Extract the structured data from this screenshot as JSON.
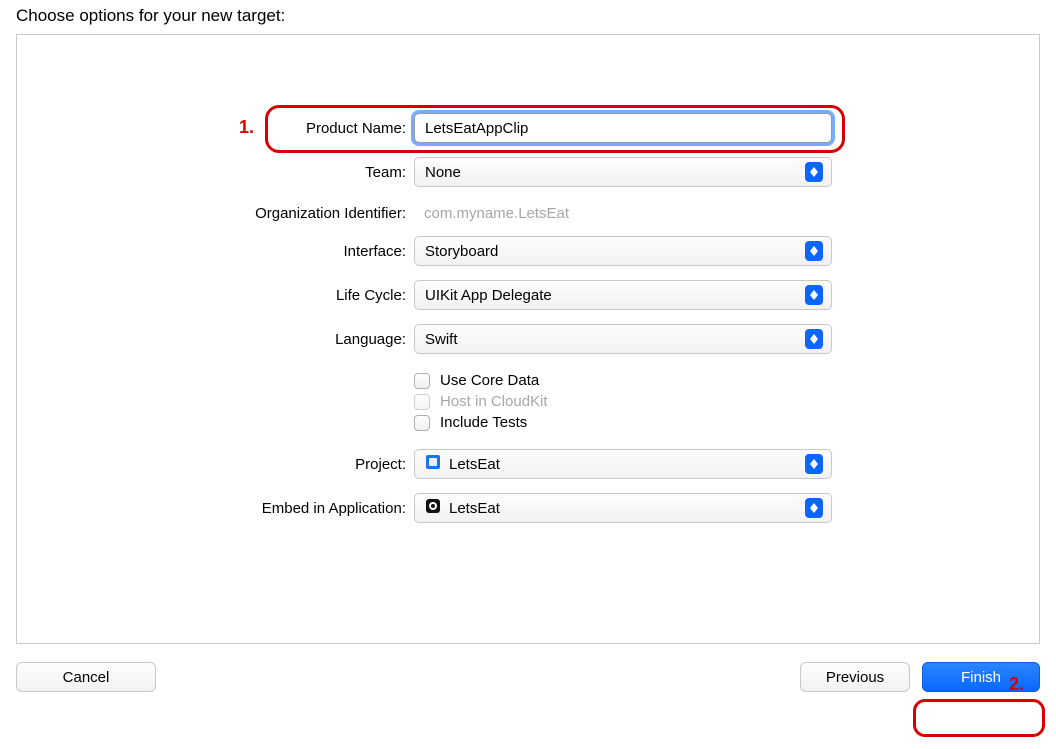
{
  "header": "Choose options for your new target:",
  "callouts": {
    "one": "1.",
    "two": "2."
  },
  "labels": {
    "productName": "Product Name:",
    "team": "Team:",
    "orgIdentifier": "Organization Identifier:",
    "interface": "Interface:",
    "lifeCycle": "Life Cycle:",
    "language": "Language:",
    "project": "Project:",
    "embedInApp": "Embed in Application:"
  },
  "fields": {
    "productName": "LetsEatAppClip",
    "team": "None",
    "orgIdentifier": "com.myname.LetsEat",
    "interface": "Storyboard",
    "lifeCycle": "UIKit App Delegate",
    "language": "Swift",
    "useCoreData": "Use Core Data",
    "hostCloudKit": "Host in CloudKit",
    "includeTests": "Include Tests",
    "project": "LetsEat",
    "embedInApp": "LetsEat"
  },
  "buttons": {
    "cancel": "Cancel",
    "previous": "Previous",
    "finish": "Finish"
  }
}
